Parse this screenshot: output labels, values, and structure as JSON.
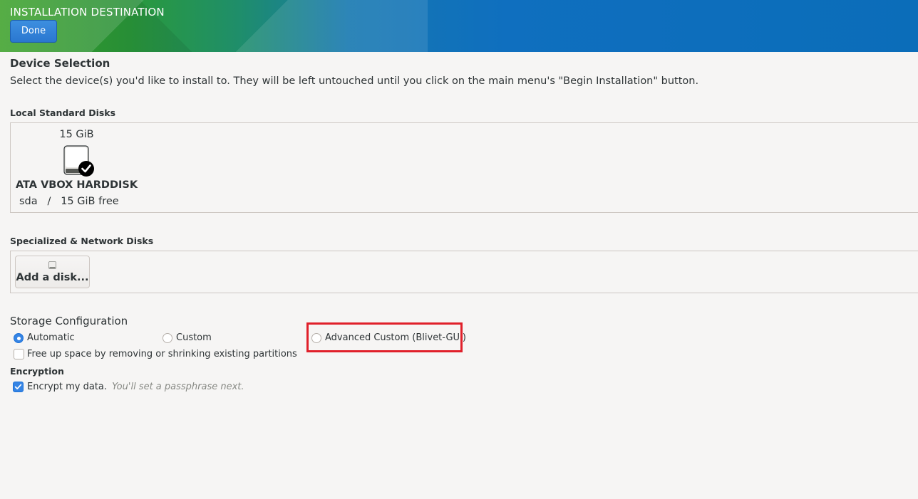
{
  "header": {
    "title": "INSTALLATION DESTINATION",
    "done_label": "Done"
  },
  "device_selection": {
    "title": "Device Selection",
    "description": "Select the device(s) you'd like to install to.  They will be left untouched until you click on the main menu's \"Begin Installation\" button."
  },
  "local_disks": {
    "label": "Local Standard Disks",
    "disks": [
      {
        "size": "15 GiB",
        "name": "ATA VBOX HARDDISK",
        "device": "sda",
        "separator": "/",
        "free": "15 GiB free",
        "selected": true
      }
    ]
  },
  "network_disks": {
    "label": "Specialized & Network Disks",
    "add_label": "Add a disk..."
  },
  "storage": {
    "title": "Storage Configuration",
    "options": [
      {
        "label": "Automatic",
        "checked": true
      },
      {
        "label": "Custom",
        "checked": false
      },
      {
        "label": "Advanced Custom (Blivet-GUI)",
        "checked": false
      }
    ],
    "free_space_label": "Free up space by removing or shrinking existing partitions",
    "free_space_checked": false
  },
  "encryption": {
    "title": "Encryption",
    "encrypt_label": "Encrypt my data.",
    "encrypt_hint": "You'll set a passphrase next.",
    "encrypt_checked": true
  },
  "colors": {
    "accent": "#3584e4",
    "highlight": "#e0202a"
  }
}
